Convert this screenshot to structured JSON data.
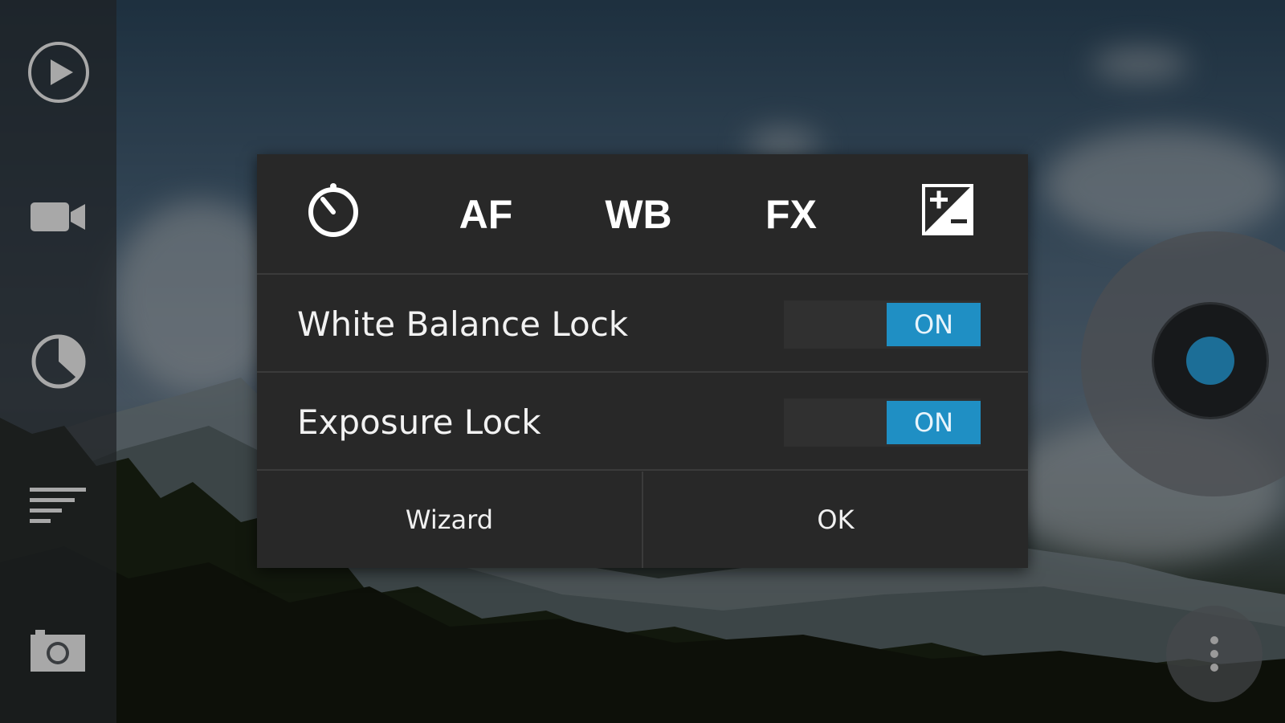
{
  "tabs": [
    {
      "id": "timer",
      "label": "",
      "icon": "timer-icon"
    },
    {
      "id": "af",
      "label": "AF",
      "icon": ""
    },
    {
      "id": "wb",
      "label": "WB",
      "icon": ""
    },
    {
      "id": "fx",
      "label": "FX",
      "icon": ""
    },
    {
      "id": "exposure",
      "label": "",
      "icon": "exposure-compensation-icon"
    }
  ],
  "settings": [
    {
      "label": "White Balance Lock",
      "toggle": "ON"
    },
    {
      "label": "Exposure Lock",
      "toggle": "ON"
    }
  ],
  "buttons": {
    "wizard": "Wizard",
    "ok": "OK"
  },
  "left_rail": [
    "play-icon",
    "video-camera-icon",
    "timer-pie-icon",
    "menu-lines-icon",
    "camera-icon"
  ],
  "colors": {
    "accent": "#1f8fc4",
    "dialog_bg": "#282828",
    "shutter_dot": "#1c6e97"
  }
}
